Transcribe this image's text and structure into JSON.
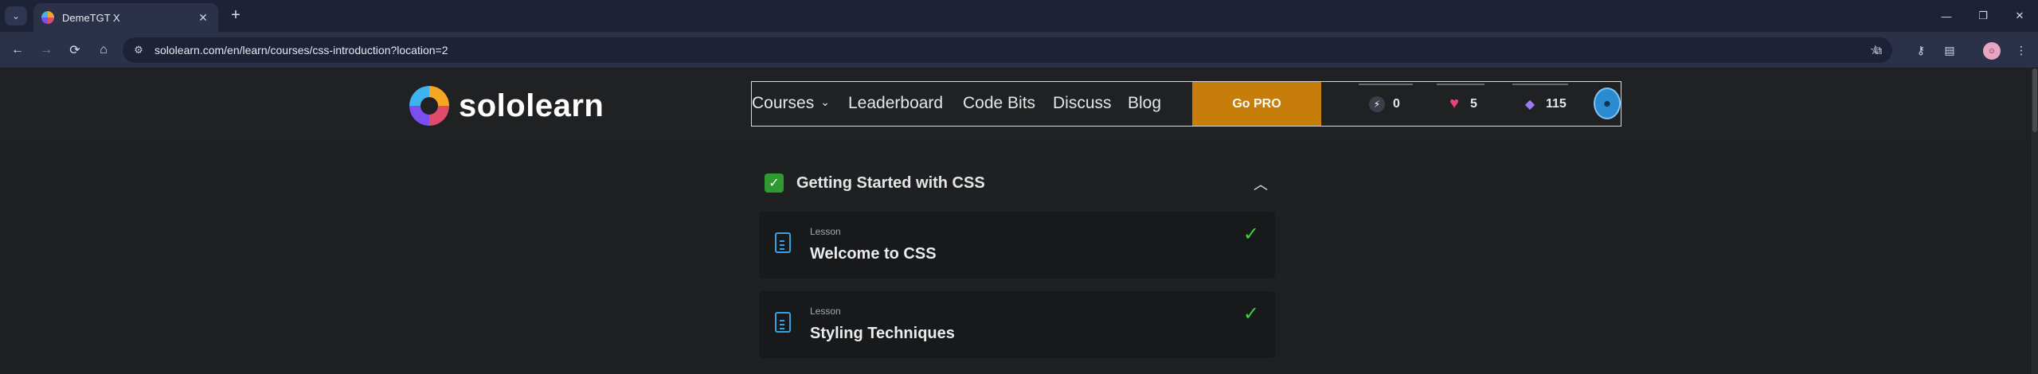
{
  "browser": {
    "tab": {
      "title": "DemeTGT X",
      "close": "✕"
    },
    "new_tab": "+",
    "window": {
      "minimize": "—",
      "restore": "❐",
      "close": "✕"
    },
    "nav": {
      "back": "←",
      "forward": "→",
      "reload": "⟳",
      "home": "⌂"
    },
    "url": "sololearn.com/en/learn/courses/css-introduction?location=2"
  },
  "site": {
    "logo_text": "sololearn",
    "nav": {
      "courses": "Courses",
      "leaderboard": "Leaderboard",
      "code_bits": "Code Bits",
      "discuss": "Discuss",
      "blog": "Blog",
      "go_pro": "Go PRO"
    },
    "stats": {
      "streak": "0",
      "hearts": "5",
      "gems": "115"
    }
  },
  "section": {
    "title": "Getting Started with CSS",
    "lessons": [
      {
        "kind": "Lesson",
        "title": "Welcome to CSS"
      },
      {
        "kind": "Lesson",
        "title": "Styling Techniques"
      }
    ]
  },
  "colors": {
    "go_pro": "#c77d0a",
    "complete_check": "#3dcf3d",
    "lesson_icon": "#3aa0e0",
    "heart": "#f0427a"
  }
}
